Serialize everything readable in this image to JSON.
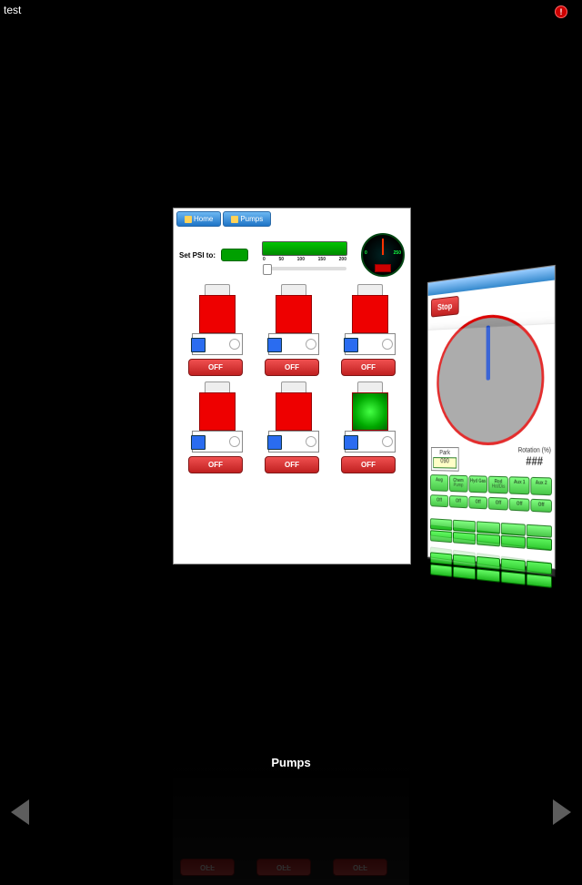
{
  "title_bar": "test",
  "caption": "Pumps",
  "main_card": {
    "tabs": [
      {
        "label": "Home",
        "icon": "home-icon"
      },
      {
        "label": "Pumps",
        "icon": "pump-icon"
      }
    ],
    "psi_label": "Set PSI to:",
    "psi_value": "",
    "bar_value": "",
    "bar_ticks": [
      "0",
      "50",
      "100",
      "150",
      "200"
    ],
    "gauge": {
      "box_label": ""
    },
    "pumps": [
      {
        "state": "OFF",
        "lit": false
      },
      {
        "state": "OFF",
        "lit": false
      },
      {
        "state": "OFF",
        "lit": false
      },
      {
        "state": "OFF",
        "lit": false
      },
      {
        "state": "OFF",
        "lit": false
      },
      {
        "state": "OFF",
        "lit": true
      }
    ]
  },
  "side_card": {
    "header": "",
    "stop": "Stop",
    "park": {
      "label": "Park",
      "sub": "",
      "value": "090"
    },
    "rotation": {
      "label": "Rotation (%)",
      "value": "###"
    },
    "buttons": [
      {
        "top": "Aug",
        "sub": ""
      },
      {
        "top": "Chem",
        "sub": "Pump"
      },
      {
        "top": "Hyd Gas",
        "sub": ""
      },
      {
        "top": "Rod",
        "sub": "Hot/Dis"
      },
      {
        "top": "Aux 1",
        "sub": ""
      },
      {
        "top": "Aux 2",
        "sub": ""
      }
    ],
    "states": [
      "Off",
      "Off",
      "Off",
      "Off",
      "Off",
      "Off"
    ],
    "gridA": [
      "",
      "",
      "",
      "",
      "",
      "",
      "",
      "",
      "",
      ""
    ],
    "gridB": [
      "",
      "",
      "",
      "",
      "",
      "",
      "",
      "",
      "",
      ""
    ]
  }
}
